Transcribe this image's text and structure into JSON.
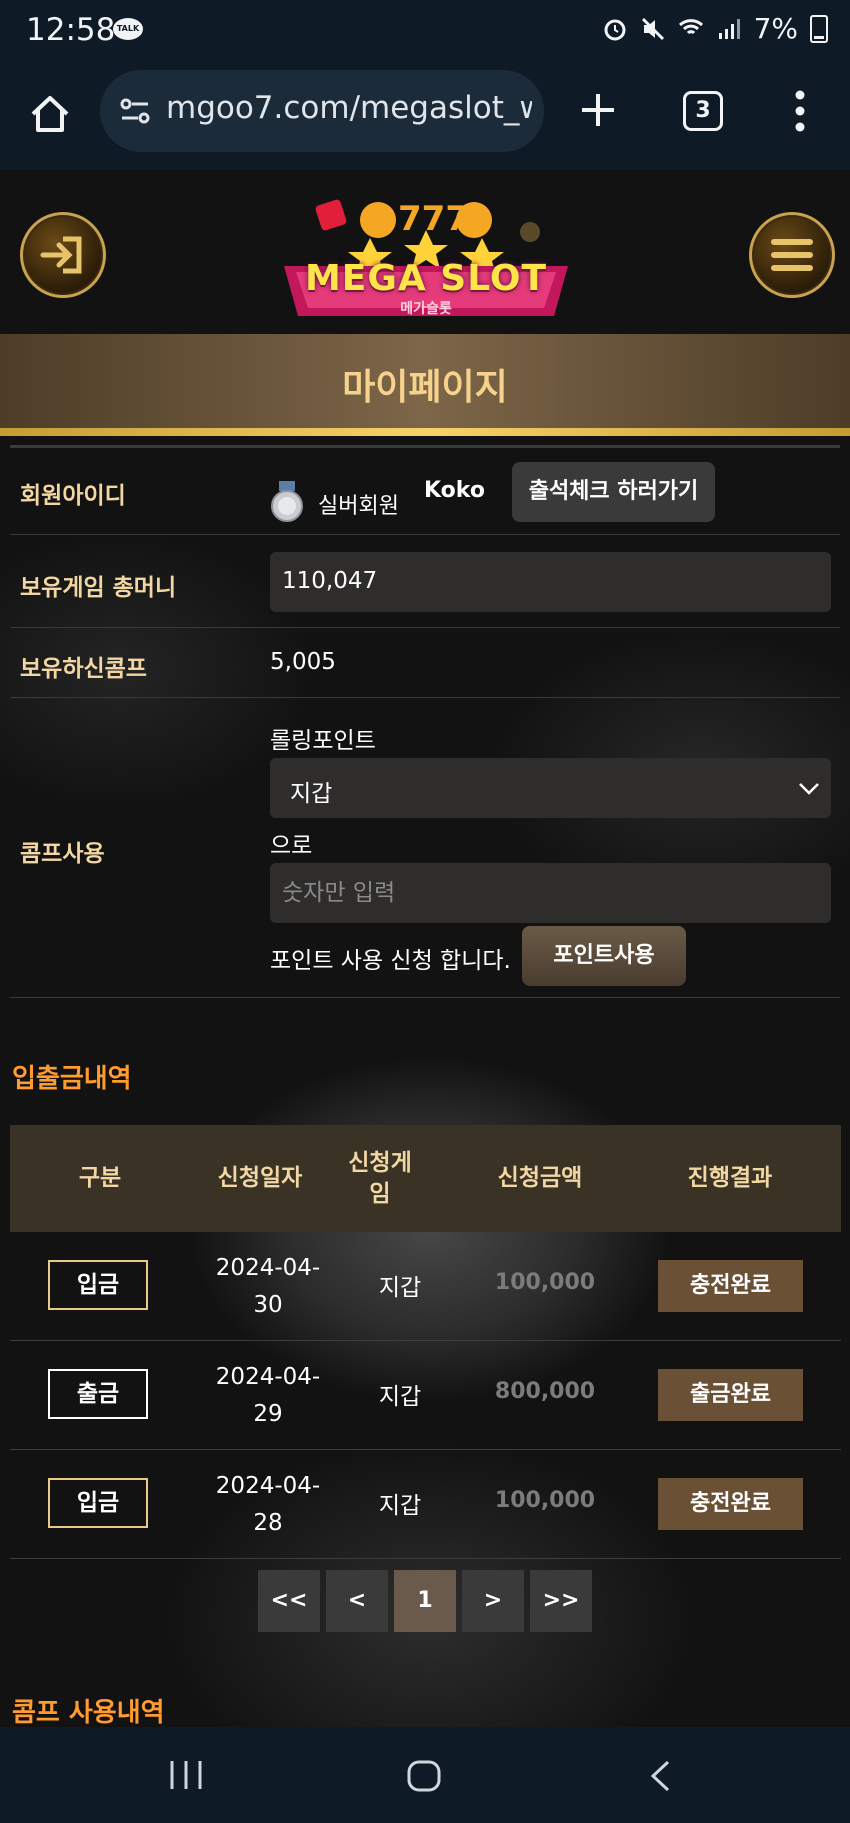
{
  "status_bar": {
    "time": "12:58",
    "talk": "TALK",
    "battery": "7%"
  },
  "browser": {
    "url": "mgoo7.com/megaslot_w",
    "tab_count": "3"
  },
  "header": {
    "logo_text": "MEGA SLOT",
    "logo_sub": "메가슬롯",
    "page_title": "마이페이지"
  },
  "profile": {
    "member_id_label": "회원아이디",
    "member_grade": "실버회원",
    "member_name": "Koko",
    "attendance_button": "출석체크 하러가기",
    "money_label": "보유게임 총머니",
    "money_value": "110,047",
    "comp_label": "보유하신콤프",
    "comp_value": "5,005",
    "comp_use_label": "콤프사용",
    "rolling_label": "롤링포인트",
    "wallet_select": "지갑",
    "to_label": "으로",
    "amount_placeholder": "숫자만 입력",
    "apply_text": "포인트 사용 신청 합니다.",
    "point_button": "포인트사용"
  },
  "history": {
    "title": "입출금내역",
    "headers": [
      "구분",
      "신청일자",
      "신청게\n임",
      "신청금액",
      "진행결과"
    ],
    "rows": [
      {
        "type": "입금",
        "date": "2024-04-\n30",
        "game": "지갑",
        "amount": "100,000",
        "result": "충전완료"
      },
      {
        "type": "출금",
        "date": "2024-04-\n29",
        "game": "지갑",
        "amount": "800,000",
        "result": "출금완료"
      },
      {
        "type": "입금",
        "date": "2024-04-\n28",
        "game": "지갑",
        "amount": "100,000",
        "result": "충전완료"
      }
    ]
  },
  "pagination": {
    "first": "<<",
    "prev": "<",
    "current": "1",
    "next": ">",
    "last": ">>"
  },
  "comp_history": {
    "title": "콤프 사용내역"
  },
  "colors": {
    "accent_gold": "#f3d7a3",
    "section_orange": "#ff9b2f",
    "result_brown": "#6a5135"
  },
  "icons": [
    "home-icon",
    "site-settings-icon",
    "plus-icon",
    "more-vert-icon",
    "login-icon",
    "menu-icon",
    "silver-medal-icon",
    "chevron-down-icon",
    "recents-icon",
    "home-circle-icon",
    "back-icon"
  ]
}
